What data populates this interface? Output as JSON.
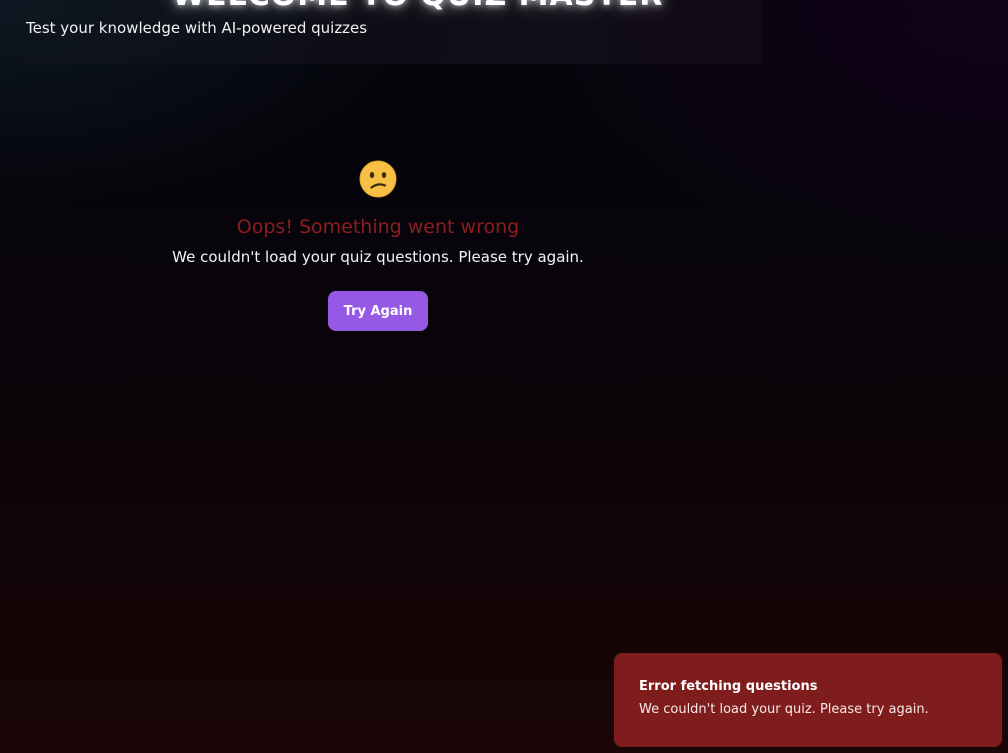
{
  "header": {
    "title": "WELCOME TO QUIZ MASTER",
    "subtitle": "Test your knowledge with AI-powered quizzes"
  },
  "error": {
    "icon": "confused-face-icon",
    "heading": "Oops! Something went wrong",
    "message": "We couldn't load your quiz questions. Please try again.",
    "retry_label": "Try Again"
  },
  "toast": {
    "title": "Error fetching questions",
    "message": "We couldn't load your quiz. Please try again."
  },
  "colors": {
    "accent_button": "#9659e6",
    "error_heading": "#8e1d1f",
    "toast_background": "#7f1d1d",
    "emoji_face": "#f7c044"
  }
}
